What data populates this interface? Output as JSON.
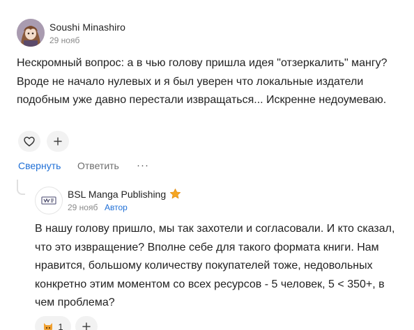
{
  "comment": {
    "author": "Soushi Minashiro",
    "date": "29 нояб",
    "text": "Нескромный вопрос: а в чью голову пришла идея \"отзеркалить\" мангу? Вроде не начало нулевых и я был уверен что локальные издатели подобным уже давно перестали извращаться... Искренне недоумеваю.",
    "reaction_icon": "heart-outline-icon",
    "add_reaction_icon": "plus-icon",
    "actions": {
      "collapse": "Свернуть",
      "reply": "Ответить",
      "more": "···"
    }
  },
  "reply": {
    "author": "BSL Manga Publishing",
    "author_icon": "star-icon",
    "date": "29 нояб",
    "badge": "Автор",
    "text": "В нашу голову пришло, мы так захотели и согласовали. И кто сказал, что это извращение? Вполне себе для такого формата книги. Нам нравится, большому количеству покупателей тоже, недовольных конкретно этим моментом со всех ресурсов - 5 человек, 5 < 350+, в чем проблема?",
    "reaction_icon": "cat-emoji-icon",
    "reaction_count": "1",
    "add_reaction_icon": "plus-icon"
  },
  "colors": {
    "link": "#1f6fd6",
    "muted": "#8a8a8a",
    "pill_bg": "#f2f2f2",
    "star": "#f5a623"
  }
}
